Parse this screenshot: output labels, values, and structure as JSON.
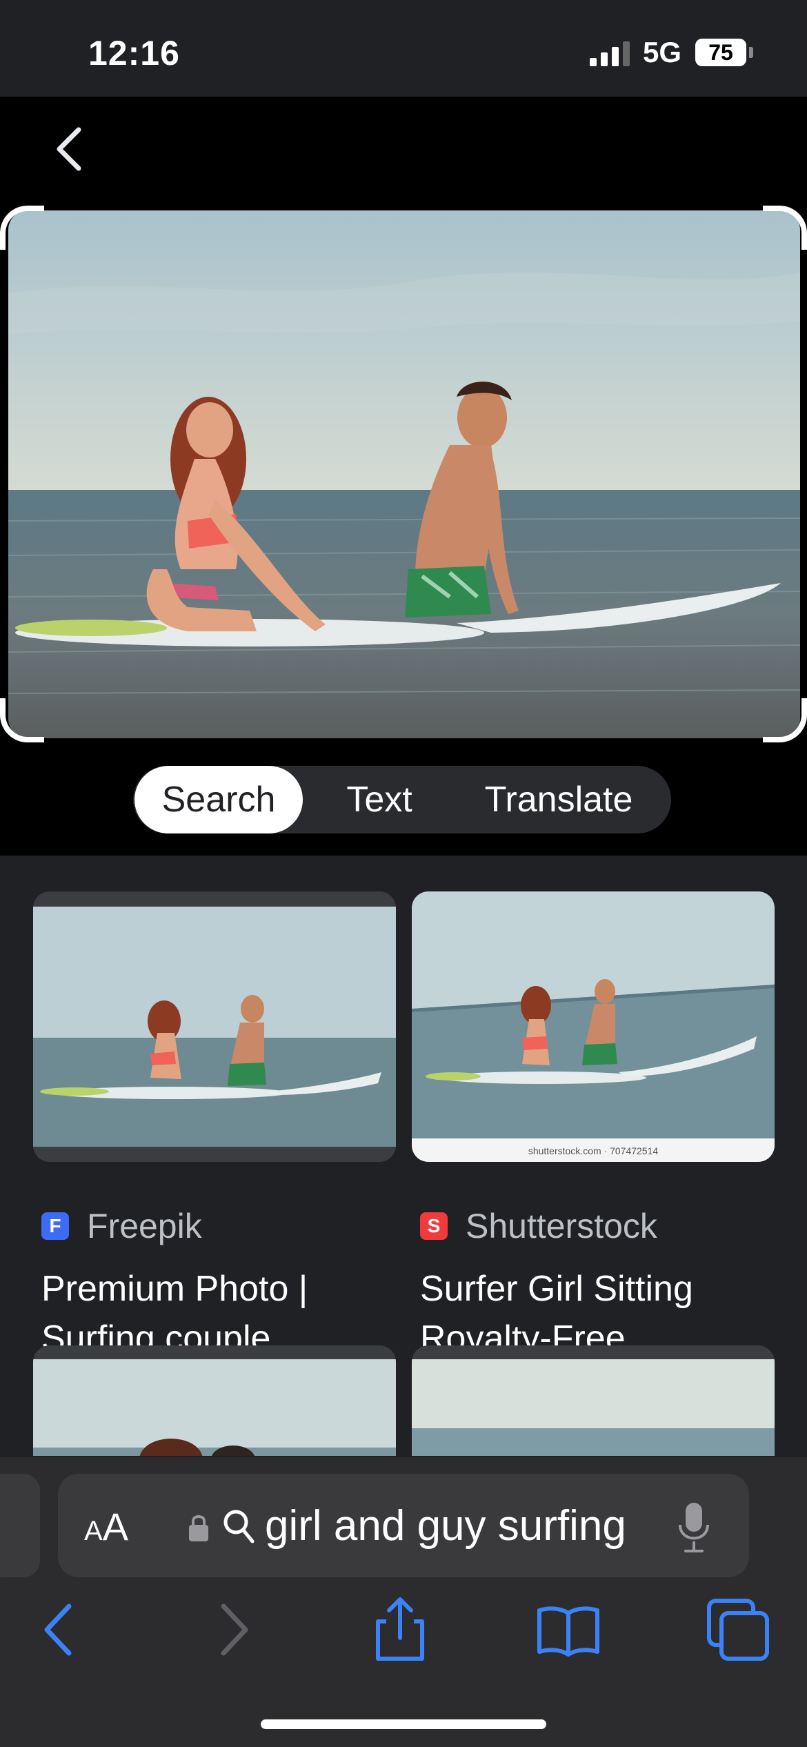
{
  "status_bar": {
    "time": "12:16",
    "network": "5G",
    "battery": "75"
  },
  "lens": {
    "modes": [
      "Search",
      "Text",
      "Translate"
    ],
    "active_mode": "Search"
  },
  "results": [
    {
      "source": "Freepik",
      "favicon_letter": "F",
      "favicon_color": "#3d6bf5",
      "title": "Premium Photo | Surfing couple…"
    },
    {
      "source": "Shutterstock",
      "favicon_letter": "S",
      "favicon_color": "#ef3b3b",
      "title": "Surfer Girl Sitting Royalty-Free…",
      "watermark": "shutterstock.com · 707472514"
    }
  ],
  "safari": {
    "text_size_label": "AA",
    "address_query": "girl and guy surfing"
  },
  "colors": {
    "accent_blue": "#3b82f6",
    "page_bg": "#202124",
    "header_bg": "#000000"
  }
}
